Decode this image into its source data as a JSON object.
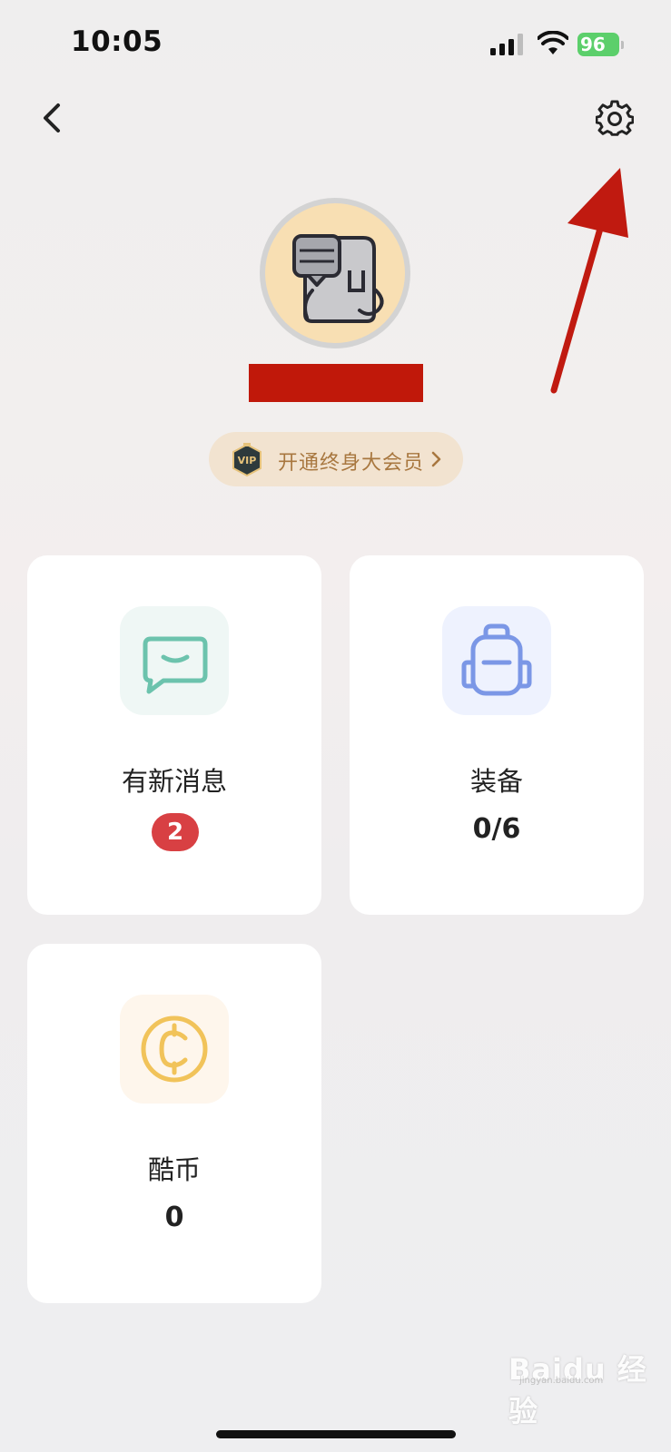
{
  "status_bar": {
    "time": "10:05",
    "battery_level": "96",
    "battery_color": "#5ccf6b",
    "icons": [
      "signal-icon",
      "wifi-icon",
      "battery-icon"
    ]
  },
  "nav": {
    "back_icon": "chevron-left-icon",
    "settings_icon": "gear-icon"
  },
  "profile": {
    "avatar_icon": "robot-avatar-icon",
    "vip_label": "开通终身大会员",
    "vip_badge_text": "VIP"
  },
  "cards": [
    {
      "id": "messages",
      "icon": "message-bubble-icon",
      "title": "有新消息",
      "badge": "2",
      "icon_bg": "#eff7f5",
      "icon_color": "#6cc3ad"
    },
    {
      "id": "equipment",
      "icon": "backpack-icon",
      "title": "装备",
      "value": "0/6",
      "icon_bg": "#eef2fe",
      "icon_color": "#7b97e6"
    },
    {
      "id": "coins",
      "icon": "coin-icon",
      "title": "酷币",
      "value": "0",
      "icon_bg": "#fef6ec",
      "icon_color": "#f1c35a"
    }
  ],
  "watermark": {
    "text": "Baidu 经验",
    "sub": "jingyan.baidu.com"
  },
  "annotation": {
    "arrow_color": "#c01a10"
  }
}
